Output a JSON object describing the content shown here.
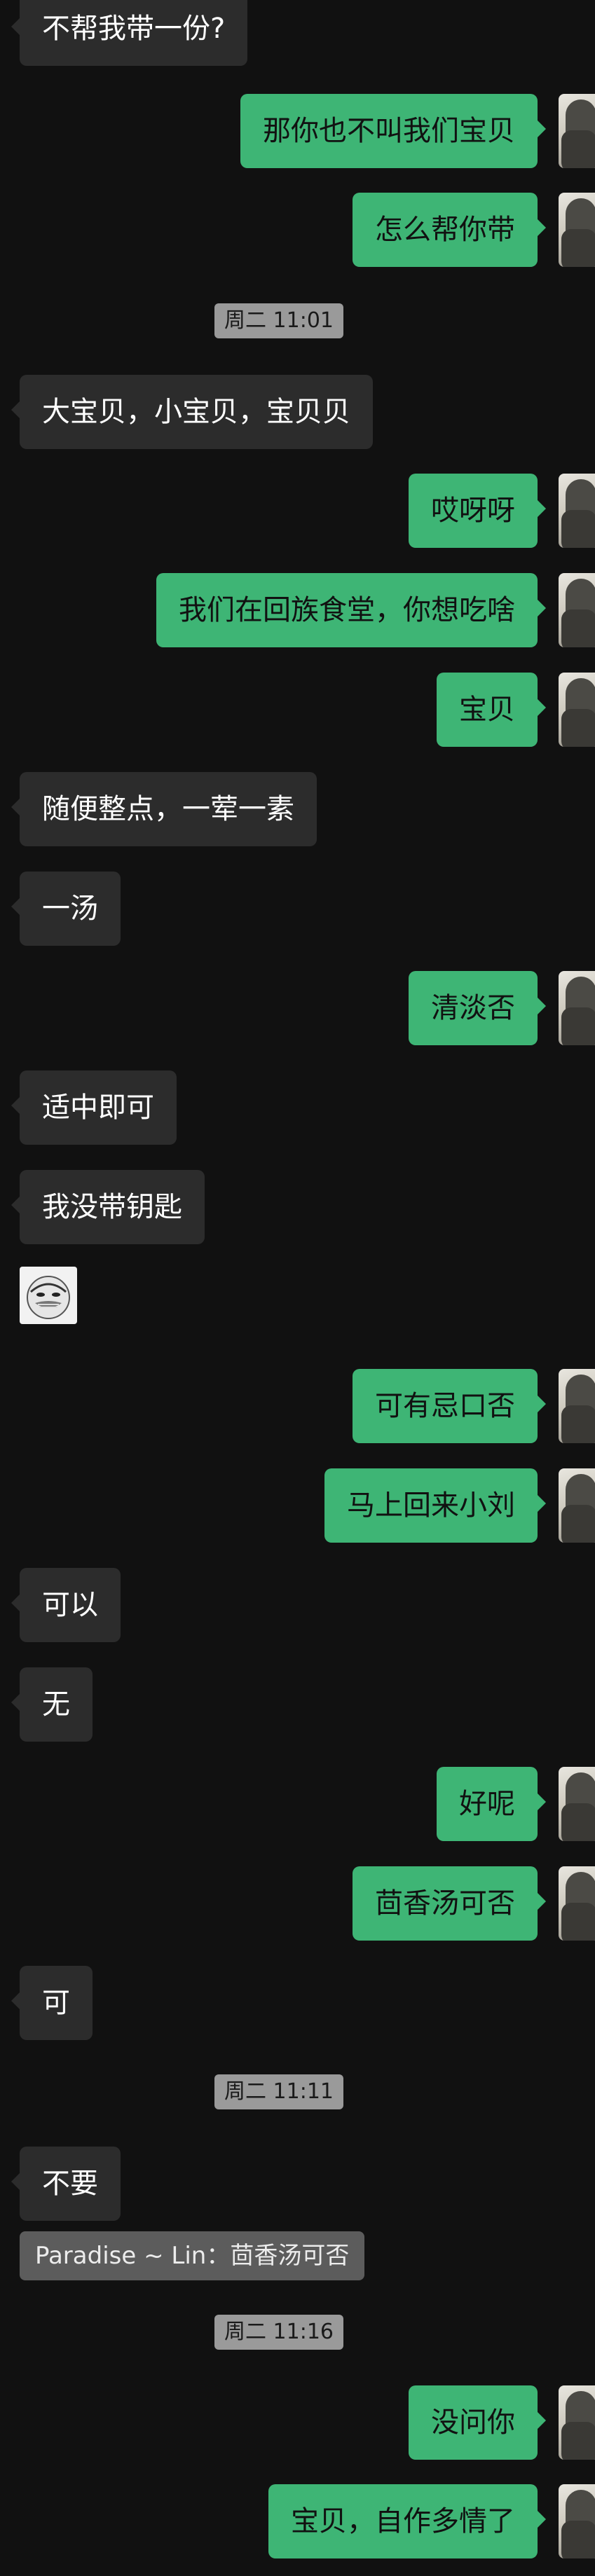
{
  "messages": [
    {
      "dir": "in",
      "text": "不帮我带一份?"
    },
    {
      "dir": "out",
      "text": "那你也不叫我们宝贝"
    },
    {
      "dir": "out",
      "text": "怎么帮你带"
    },
    {
      "ts": "周二 11:01"
    },
    {
      "dir": "in",
      "text": "大宝贝，小宝贝，宝贝贝"
    },
    {
      "dir": "out",
      "text": "哎呀呀"
    },
    {
      "dir": "out",
      "text": "我们在回族食堂，你想吃啥"
    },
    {
      "dir": "out",
      "text": "宝贝"
    },
    {
      "dir": "in",
      "text": "随便整点，一荤一素"
    },
    {
      "dir": "in",
      "text": "一汤"
    },
    {
      "dir": "out",
      "text": "清淡否"
    },
    {
      "dir": "in",
      "text": "适中即可"
    },
    {
      "dir": "in",
      "text": "我没带钥匙"
    },
    {
      "sticker": "meme-face-sticker"
    },
    {
      "dir": "out",
      "text": "可有忌口否"
    },
    {
      "dir": "out",
      "text": "马上回来小刘"
    },
    {
      "dir": "in",
      "text": "可以"
    },
    {
      "dir": "in",
      "text": "无"
    },
    {
      "dir": "out",
      "text": "好呢"
    },
    {
      "dir": "out",
      "text": "茴香汤可否"
    },
    {
      "dir": "in",
      "text": "可"
    },
    {
      "ts": "周二 11:11"
    },
    {
      "dir": "in",
      "text": "不要"
    },
    {
      "quote": "Paradise ~ Lin：茴香汤可否"
    },
    {
      "ts": "周二 11:16"
    },
    {
      "dir": "out",
      "text": "没问你"
    },
    {
      "dir": "out",
      "text": "宝贝，自作多情了"
    }
  ]
}
